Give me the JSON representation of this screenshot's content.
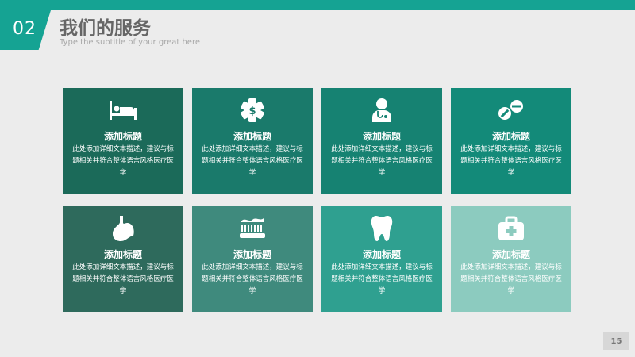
{
  "header": {
    "number": "02",
    "title": "我们的服务",
    "subtitle": "Type the subtitle of your great here"
  },
  "cards": [
    {
      "title": "添加标题",
      "desc": "此处添加详细文本描述，建议与标题相关并符合整体语言风格医疗医学",
      "icon": "hospital-bed-icon",
      "color": "#1b6a59"
    },
    {
      "title": "添加标题",
      "desc": "此处添加详细文本描述，建议与标题相关并符合整体语言风格医疗医学",
      "icon": "medical-cross-icon",
      "color": "#1a7a6b"
    },
    {
      "title": "添加标题",
      "desc": "此处添加详细文本描述，建议与标题相关并符合整体语言风格医疗医学",
      "icon": "doctor-icon",
      "color": "#168272"
    },
    {
      "title": "添加标题",
      "desc": "此处添加详细文本描述，建议与标题相关并符合整体语言风格医疗医学",
      "icon": "pills-icon",
      "color": "#138a79"
    },
    {
      "title": "添加标题",
      "desc": "此处添加详细文本描述，建议与标题相关并符合整体语言风格医疗医学",
      "icon": "stomach-icon",
      "color": "#2e6a5c"
    },
    {
      "title": "添加标题",
      "desc": "此处添加详细文本描述，建议与标题相关并符合整体语言风格医疗医学",
      "icon": "toothbrush-icon",
      "color": "#3f8a7d"
    },
    {
      "title": "添加标题",
      "desc": "此处添加详细文本描述，建议与标题相关并符合整体语言风格医疗医学",
      "icon": "tooth-icon",
      "color": "#2fa090"
    },
    {
      "title": "添加标题",
      "desc": "此处添加详细文本描述，建议与标题相关并符合整体语言风格医疗医学",
      "icon": "first-aid-kit-icon",
      "color": "#8ccbbf"
    }
  ],
  "footer": {
    "page_number": "15"
  }
}
